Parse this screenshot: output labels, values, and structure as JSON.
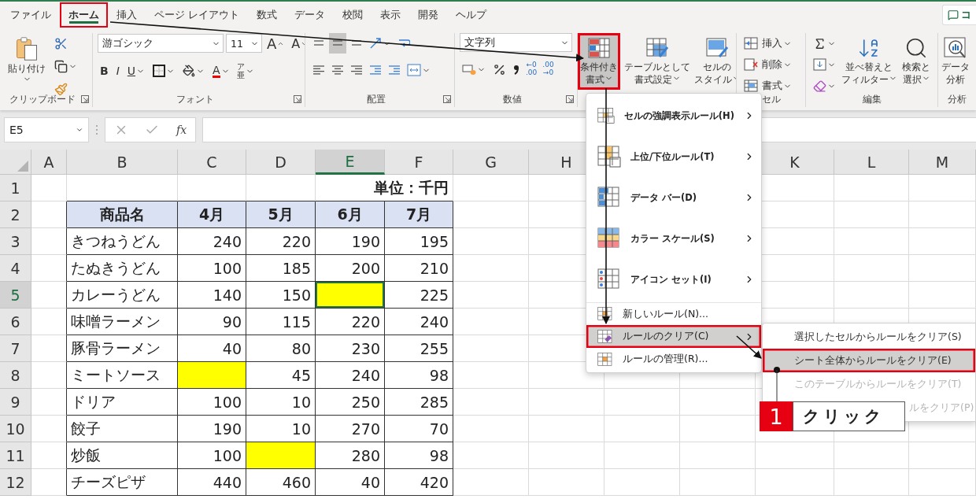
{
  "tabs": [
    {
      "label": "ファイル",
      "selected": false,
      "highlighted": false
    },
    {
      "label": "ホーム",
      "selected": true,
      "highlighted": true
    },
    {
      "label": "挿入",
      "selected": false,
      "highlighted": false
    },
    {
      "label": "ページ レイアウト",
      "selected": false,
      "highlighted": false
    },
    {
      "label": "数式",
      "selected": false,
      "highlighted": false
    },
    {
      "label": "データ",
      "selected": false,
      "highlighted": false
    },
    {
      "label": "校閲",
      "selected": false,
      "highlighted": false
    },
    {
      "label": "表示",
      "selected": false,
      "highlighted": false
    },
    {
      "label": "開発",
      "selected": false,
      "highlighted": false
    },
    {
      "label": "ヘルプ",
      "selected": false,
      "highlighted": false
    }
  ],
  "comment_button": {
    "label": "コ"
  },
  "ribbon": {
    "groups": [
      {
        "kind": "clipboard",
        "label": "クリップボード",
        "launcher": true,
        "paste": "貼り付け"
      },
      {
        "kind": "font",
        "label": "フォント",
        "launcher": true,
        "font_name": "游ゴシック",
        "font_size": "11",
        "grow": "A",
        "shrink": "A",
        "bold": "B",
        "italic": "I",
        "underline": "U",
        "font_color": "A",
        "phonetic_top": "ア",
        "phonetic_bottom": "亜"
      },
      {
        "kind": "alignment",
        "label": "配置",
        "launcher": true
      },
      {
        "kind": "number",
        "label": "数値",
        "launcher": true,
        "format": "文字列",
        "decimal_buttons": [
          {
            "top": "←0",
            "bottom": ".00"
          },
          {
            "top": ".00",
            "bottom": "→0"
          }
        ]
      },
      {
        "kind": "styles",
        "buttons": [
          {
            "lines": [
              "条件付き",
              "書式"
            ],
            "pressed": true,
            "highlighted": true
          },
          {
            "lines": [
              "テーブルとして",
              "書式設定"
            ],
            "pressed": false,
            "highlighted": false
          },
          {
            "lines": [
              "セルの",
              "スタイル"
            ],
            "pressed": false,
            "highlighted": false
          }
        ]
      },
      {
        "kind": "cells",
        "label": "セル",
        "buttons": [
          "挿入",
          "削除",
          "書式"
        ]
      },
      {
        "kind": "editing",
        "label": "編集",
        "buttons": [
          {
            "lines": [
              "並べ替えと",
              "フィルター"
            ]
          },
          {
            "lines": [
              "検索と",
              "選択"
            ]
          }
        ]
      },
      {
        "kind": "analysis",
        "label": "分析",
        "lines": [
          "データ",
          "分析"
        ]
      }
    ]
  },
  "formula_bar": {
    "name_box": "E5",
    "function_label": "fx"
  },
  "sheet": {
    "columns": [
      "A",
      "B",
      "C",
      "D",
      "E",
      "F",
      "G",
      "H",
      "K",
      "L",
      "M"
    ],
    "row_numbers": [
      "1",
      "2",
      "3",
      "4",
      "5",
      "6",
      "7",
      "8",
      "9",
      "10",
      "11",
      "12"
    ]
  },
  "table": {
    "unit": "単位：千円",
    "headers": [
      "商品名",
      "4月",
      "5月",
      "6月",
      "7月"
    ],
    "rows": [
      {
        "name": "きつねうどん",
        "values": [
          {
            "text": "240",
            "selected": false
          },
          {
            "text": "220",
            "selected": false
          },
          {
            "text": "190",
            "selected": false
          },
          {
            "text": "195",
            "selected": false
          }
        ]
      },
      {
        "name": "たぬきうどん",
        "values": [
          {
            "text": "100",
            "selected": false
          },
          {
            "text": "185",
            "selected": false
          },
          {
            "text": "200",
            "selected": false
          },
          {
            "text": "210",
            "selected": false
          }
        ]
      },
      {
        "name": "カレーうどん",
        "values": [
          {
            "text": "140",
            "selected": false
          },
          {
            "text": "150",
            "selected": false
          },
          {
            "selected": true,
            "color": "#ffff00"
          },
          {
            "text": "225",
            "selected": false
          }
        ]
      },
      {
        "name": "味噌ラーメン",
        "values": [
          {
            "text": "90",
            "selected": false
          },
          {
            "text": "115",
            "selected": false
          },
          {
            "text": "220",
            "selected": false
          },
          {
            "text": "240",
            "selected": false
          }
        ]
      },
      {
        "name": "豚骨ラーメン",
        "values": [
          {
            "text": "40",
            "selected": false
          },
          {
            "text": "80",
            "selected": false
          },
          {
            "text": "230",
            "selected": false
          },
          {
            "text": "255",
            "selected": false
          }
        ]
      },
      {
        "name": "ミートソース",
        "values": [
          {
            "selected": false,
            "color": "#ffff00"
          },
          {
            "text": "45",
            "selected": false
          },
          {
            "text": "240",
            "selected": false
          },
          {
            "text": "98",
            "selected": false
          }
        ]
      },
      {
        "name": "ドリア",
        "values": [
          {
            "text": "100",
            "selected": false
          },
          {
            "text": "10",
            "selected": false
          },
          {
            "text": "250",
            "selected": false
          },
          {
            "text": "285",
            "selected": false
          }
        ]
      },
      {
        "name": "餃子",
        "values": [
          {
            "text": "190",
            "selected": false
          },
          {
            "text": "10",
            "selected": false
          },
          {
            "text": "270",
            "selected": false
          },
          {
            "text": "70",
            "selected": false
          }
        ]
      },
      {
        "name": "炒飯",
        "values": [
          {
            "text": "100",
            "selected": false
          },
          {
            "selected": false,
            "color": "#ffff00"
          },
          {
            "text": "280",
            "selected": false
          },
          {
            "text": "98",
            "selected": false
          }
        ]
      },
      {
        "name": "チーズピザ",
        "values": [
          {
            "text": "440",
            "selected": false
          },
          {
            "text": "460",
            "selected": false
          },
          {
            "text": "40",
            "selected": false
          },
          {
            "text": "420",
            "selected": false
          }
        ]
      }
    ]
  },
  "menu": {
    "items": [
      {
        "kind": "rule",
        "label": "セルの強調表示ルール(H)",
        "submenu": true,
        "selected": false,
        "highlighted": false
      },
      {
        "kind": "rule",
        "label": "上位/下位ルール(T)",
        "submenu": true,
        "selected": false,
        "highlighted": false
      },
      {
        "kind": "rule",
        "label": "データ バー(D)",
        "submenu": true,
        "selected": false,
        "highlighted": false
      },
      {
        "kind": "rule",
        "label": "カラー スケール(S)",
        "submenu": true,
        "selected": false,
        "highlighted": false
      },
      {
        "kind": "rule",
        "label": "アイコン セット(I)",
        "submenu": true,
        "selected": false,
        "highlighted": false
      },
      {
        "kind": "action",
        "label": "新しいルール(N)...",
        "submenu": false,
        "selected": false,
        "highlighted": false
      },
      {
        "kind": "action",
        "label": "ルールのクリア(C)",
        "submenu": true,
        "selected": true,
        "highlighted": true
      },
      {
        "kind": "action",
        "label": "ルールの管理(R)...",
        "submenu": false,
        "selected": false,
        "highlighted": false
      }
    ]
  },
  "submenu": {
    "items": [
      {
        "label": "選択したセルからルールをクリア(S)",
        "selected": false,
        "highlighted": false,
        "disabled": false,
        "covered": false
      },
      {
        "label": "シート全体からルールをクリア(E)",
        "selected": true,
        "highlighted": true,
        "disabled": false,
        "covered": false
      },
      {
        "label": "このテーブルからルールをクリア(T)",
        "selected": false,
        "highlighted": false,
        "disabled": true,
        "covered": false
      },
      {
        "label": "ルをクリア(P)",
        "selected": false,
        "highlighted": false,
        "disabled": true,
        "covered": true
      }
    ]
  },
  "callout": {
    "number": "1",
    "text": "クリック"
  }
}
